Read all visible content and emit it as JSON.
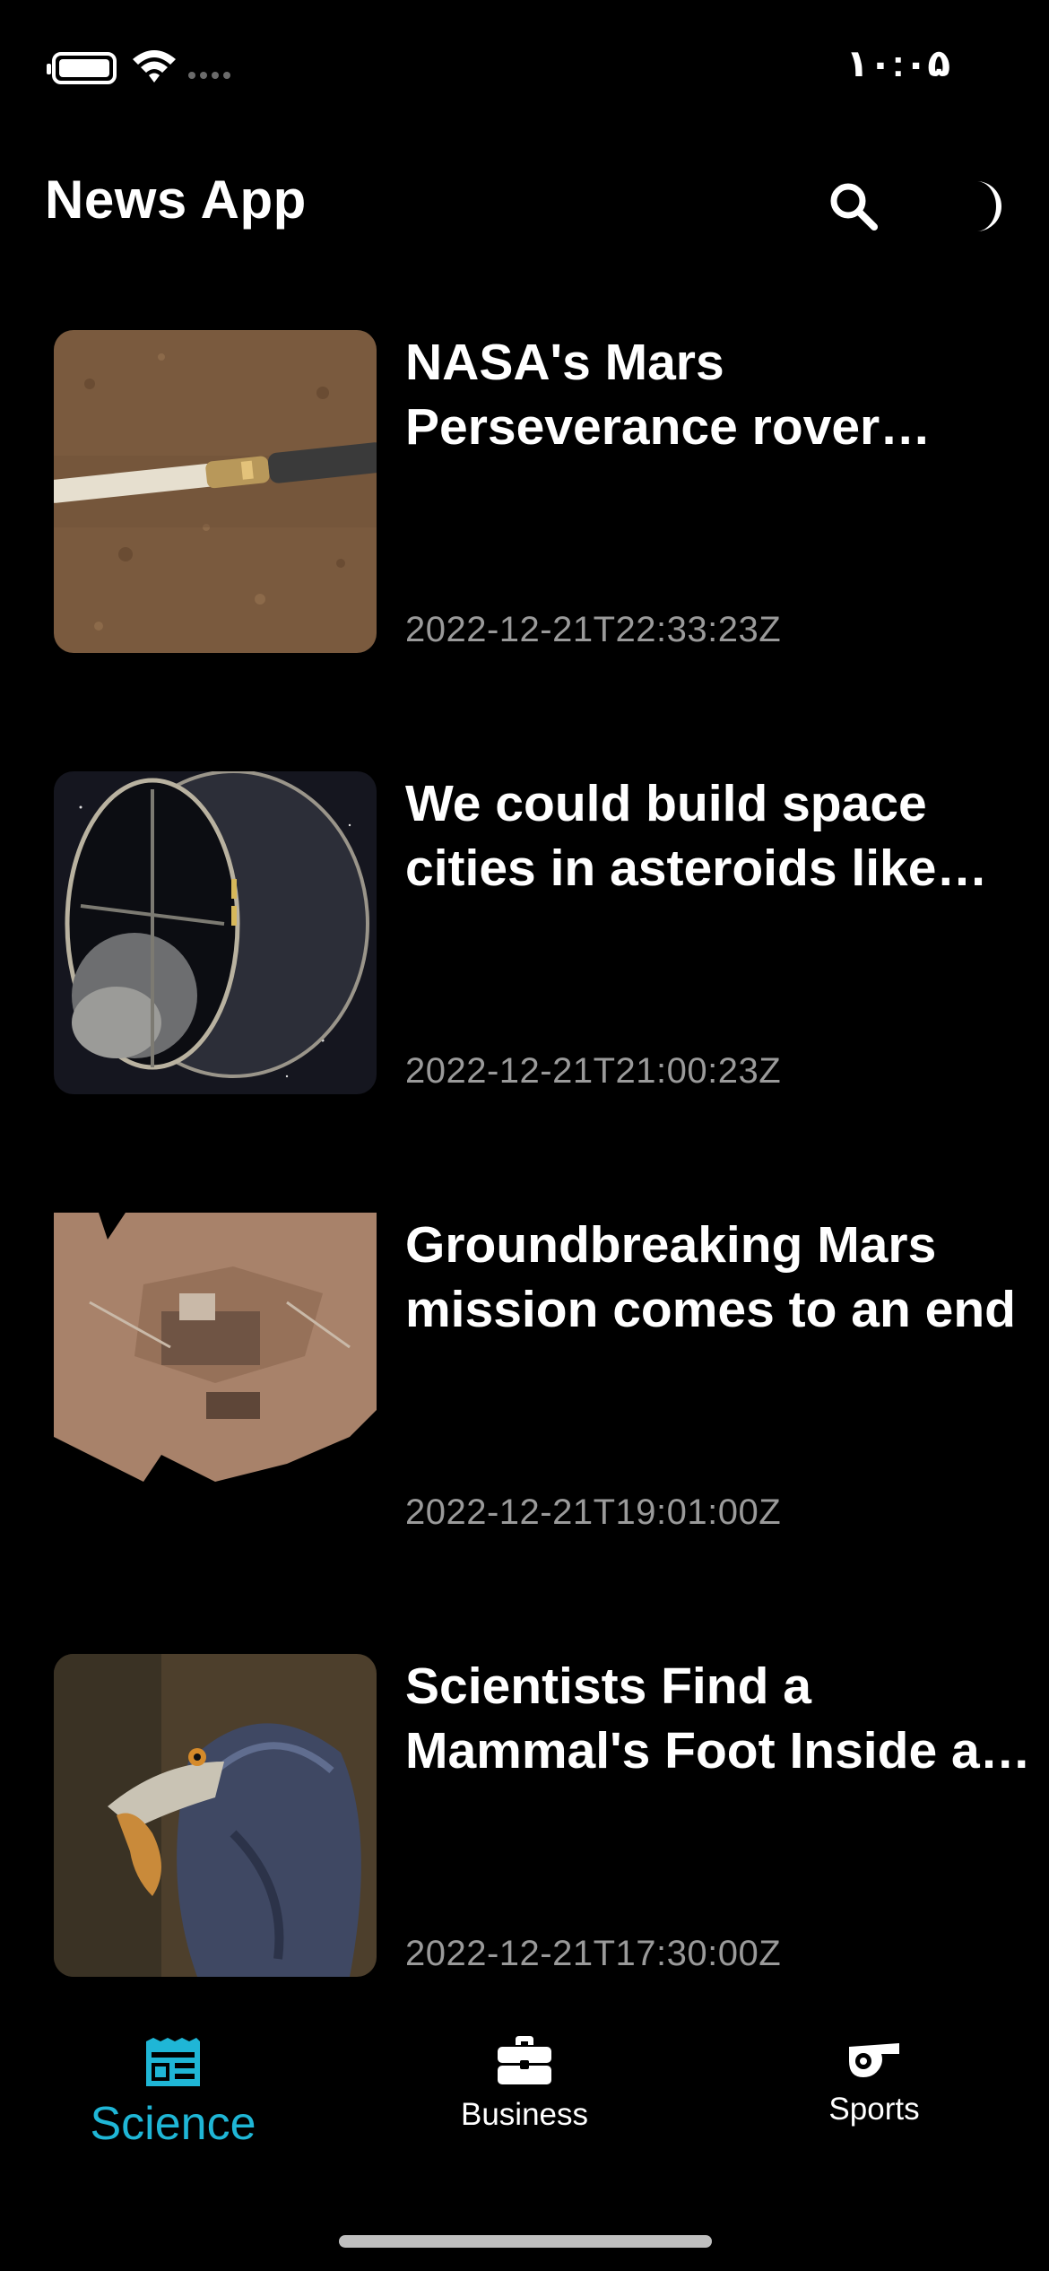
{
  "status_bar": {
    "time": "۱۰:۰۵",
    "battery_icon": "battery-full-icon",
    "wifi_icon": "wifi-icon"
  },
  "header": {
    "title": "News App",
    "search_icon": "search-icon",
    "theme_icon": "moon-icon"
  },
  "articles": [
    {
      "title": "NASA's Mars Perseverance rover collects first sample of regolith",
      "date": "2022-12-21T22:33:23Z",
      "image": "sample-tube-on-mars-surface"
    },
    {
      "title": "We could build space cities in asteroids like giant spinning habitats",
      "date": "2022-12-21T21:00:23Z",
      "image": "spinning-space-habitat"
    },
    {
      "title": "Groundbreaking Mars mission comes to an end",
      "date": "2022-12-21T19:01:00Z",
      "image": "mars-lander-selfie"
    },
    {
      "title": "Scientists Find a Mammal's Foot Inside a Dinosaur Fossil",
      "date": "2022-12-21T17:30:00Z",
      "image": "feathered-dinosaur-illustration"
    }
  ],
  "tabs": [
    {
      "label": "Science",
      "icon": "newspaper-icon",
      "active": true
    },
    {
      "label": "Business",
      "icon": "briefcase-icon",
      "active": false
    },
    {
      "label": "Sports",
      "icon": "whistle-icon",
      "active": false
    }
  ],
  "colors": {
    "background": "#000000",
    "accent": "#1fb6d6",
    "text": "#ffffff",
    "muted": "#9a9a9a"
  }
}
